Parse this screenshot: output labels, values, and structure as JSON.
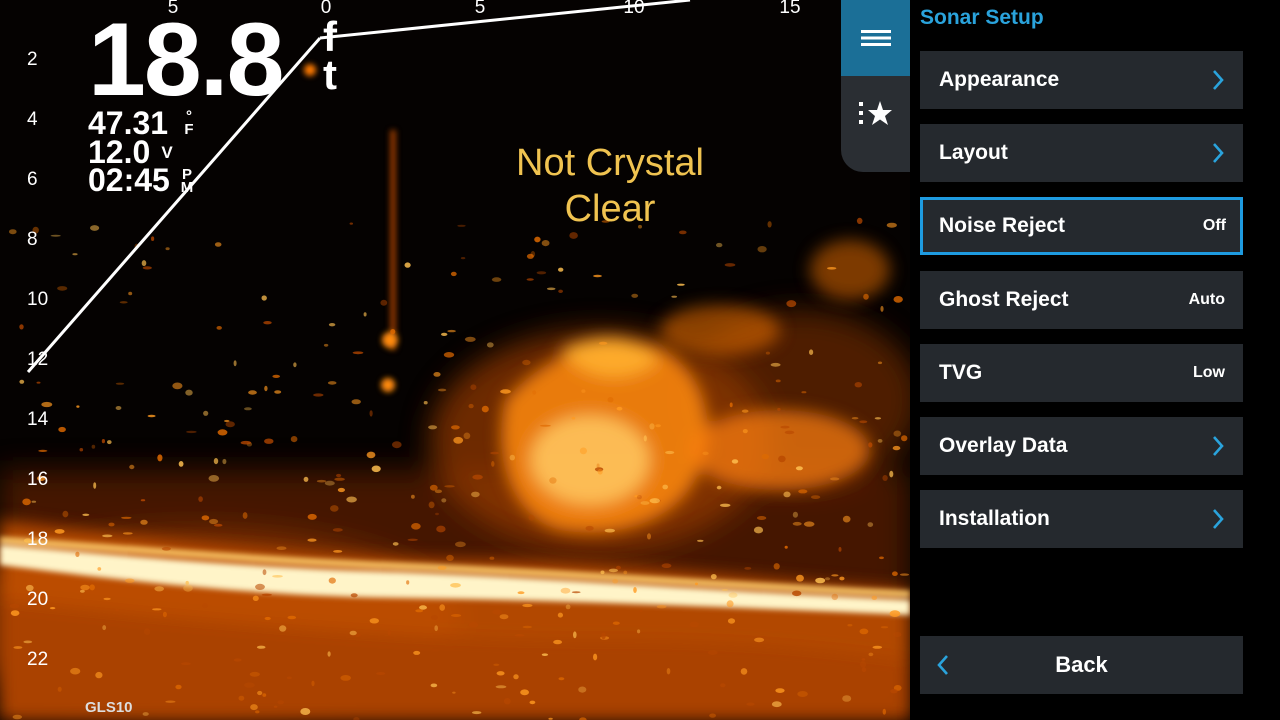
{
  "sonar": {
    "depth_value": "18.8",
    "depth_unit_top": "f",
    "depth_unit_bottom": "t",
    "water_temp": "47.31",
    "water_temp_unit_top": "°",
    "water_temp_unit_bottom": "F",
    "voltage": "12.0",
    "voltage_unit": "V",
    "time": "02:45",
    "time_period_top": "P",
    "time_period_bottom": "M",
    "depth_scale": [
      "2",
      "4",
      "6",
      "8",
      "10",
      "12",
      "14",
      "16",
      "18",
      "20",
      "22"
    ],
    "range_scale": [
      "5",
      "0",
      "5",
      "10",
      "15"
    ],
    "overlay_note_line1": "Not Crystal",
    "overlay_note_line2": "Clear",
    "transducer": "GLS10"
  },
  "tabs": {
    "menu_icon": "hamburger-icon",
    "favorites_icon": "list-star-icon"
  },
  "menu": {
    "title": "Sonar Setup",
    "items": [
      {
        "label": "Appearance",
        "value": "",
        "icon": "chevron-right-icon"
      },
      {
        "label": "Layout",
        "value": "",
        "icon": "chevron-right-icon"
      },
      {
        "label": "Noise Reject",
        "value": "Off",
        "selected": true
      },
      {
        "label": "Ghost Reject",
        "value": "Auto"
      },
      {
        "label": "TVG",
        "value": "Low"
      },
      {
        "label": "Overlay Data",
        "value": "",
        "icon": "chevron-right-icon"
      },
      {
        "label": "Installation",
        "value": "",
        "icon": "chevron-right-icon"
      }
    ],
    "back_label": "Back",
    "back_icon": "chevron-left-icon"
  },
  "colors": {
    "accent": "#1e9be0",
    "title": "#2aa3dc",
    "note": "#f0c350",
    "sonar_hot": "#fff4c8",
    "sonar_mid": "#ff8a10",
    "sonar_low": "#b53a00"
  }
}
